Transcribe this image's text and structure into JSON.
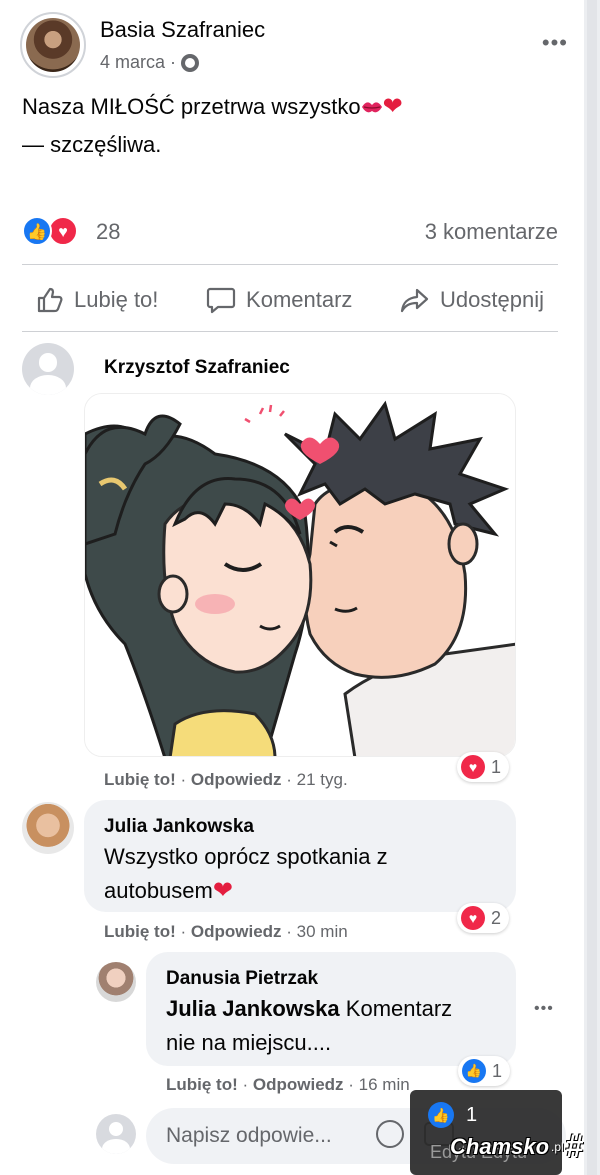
{
  "post": {
    "author": "Basia Szafraniec",
    "date": "4 marca",
    "date_separator": "·",
    "text_line1": "Nasza MIŁOŚĆ przetrwa wszystko",
    "text_line2": "— szczęśliwa.",
    "reaction_count": "28",
    "comments_count": "3 komentarze"
  },
  "actions": {
    "like": "Lubię to!",
    "comment": "Komentarz",
    "share": "Udostępnij"
  },
  "comments": [
    {
      "author": "Krzysztof Szafraniec",
      "like_label": "Lubię to!",
      "reply_label": "Odpowiedz",
      "time": "21 tyg.",
      "reaction_count": "1"
    },
    {
      "author": "Julia Jankowska",
      "text_line1": "Wszystko oprócz spotkania z",
      "text_line2": "autobusem",
      "like_label": "Lubię to!",
      "reply_label": "Odpowiedz",
      "time": "30 min",
      "reaction_count": "2"
    },
    {
      "author": "Danusia Pietrzak",
      "mention": "Julia Jankowska",
      "text_line1": "Komentarz",
      "text_line2": "nie na miejscu....",
      "like_label": "Lubię to!",
      "reply_label": "Odpowiedz",
      "time": "16 min",
      "reaction_count": "1"
    }
  ],
  "reply_box": {
    "placeholder": "Napisz odpowie..."
  },
  "overlay": {
    "count": "1",
    "edit_label": "Edytu Edytu"
  },
  "watermark": {
    "text": "Chamsko",
    "suffix": ".pl"
  },
  "colors": {
    "accent": "#1877f2",
    "love": "#f02849",
    "muted": "#65676b",
    "bubble": "#f0f2f5"
  },
  "icons": {
    "like_reaction": "thumbs-up-icon",
    "love_reaction": "heart-icon",
    "globe": "globe-icon",
    "more": "more-icon",
    "share": "share-arrow-icon"
  }
}
